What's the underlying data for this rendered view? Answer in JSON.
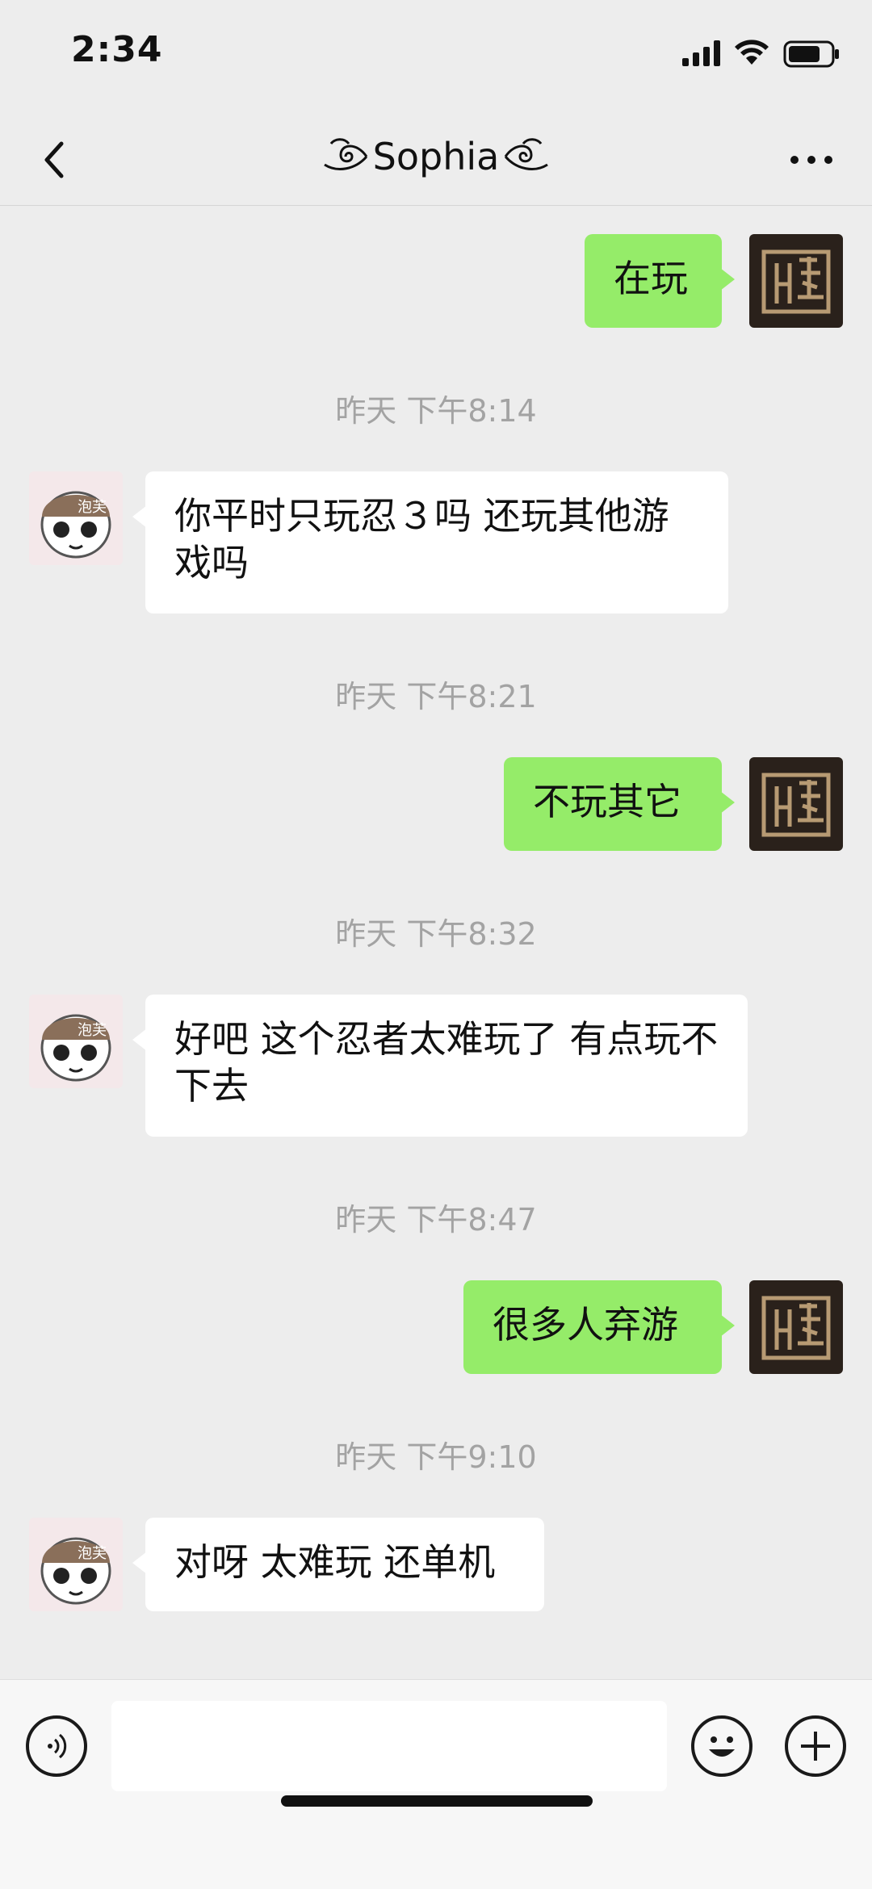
{
  "status_bar": {
    "time": "2:34"
  },
  "header": {
    "title": "Sophia"
  },
  "messages": [
    {
      "side": "me",
      "text": "在玩"
    },
    {
      "timestamp": "昨天 下午8:14"
    },
    {
      "side": "her",
      "text": "你平时只玩忍３吗 还玩其他游戏吗"
    },
    {
      "timestamp": "昨天 下午8:21"
    },
    {
      "side": "me",
      "text": "不玩其它"
    },
    {
      "timestamp": "昨天 下午8:32"
    },
    {
      "side": "her",
      "text": "好吧 这个忍者太难玩了 有点玩不下去"
    },
    {
      "timestamp": "昨天 下午8:47"
    },
    {
      "side": "me",
      "text": "很多人弃游"
    },
    {
      "timestamp": "昨天 下午9:10"
    },
    {
      "side": "her",
      "text": "对呀 太难玩 还单机"
    }
  ],
  "avatars": {
    "her_caption": "泡芙"
  },
  "colors": {
    "background": "#ededed",
    "my_bubble": "#95ec69",
    "her_bubble": "#ffffff"
  },
  "input_bar": {
    "left_icon": "voice-icon",
    "right_icons": [
      "emoji-icon",
      "plus-icon"
    ]
  }
}
